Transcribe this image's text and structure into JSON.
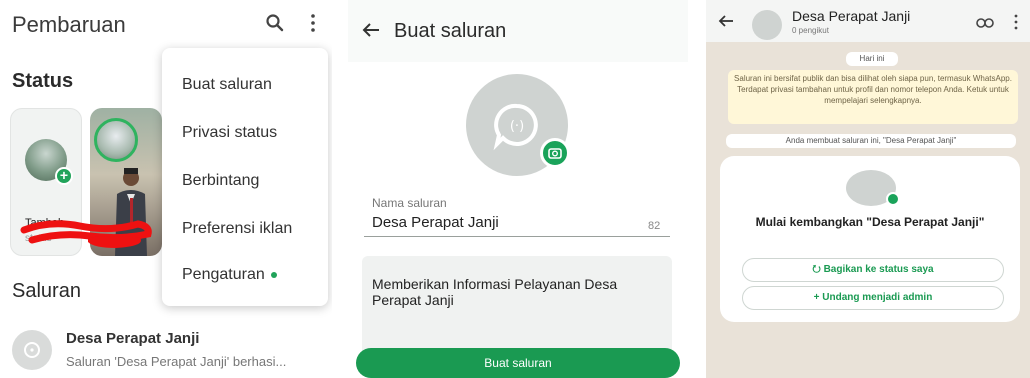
{
  "panel1": {
    "title": "Pembaruan",
    "icons": {
      "search": "search-icon",
      "menu": "kebab-menu-icon"
    },
    "status_heading": "Status",
    "status_add": {
      "label": "Tambah",
      "sublabel": "status"
    },
    "channels_heading": "Saluran",
    "channel": {
      "name": "Desa Perapat Janji",
      "preview": "Saluran 'Desa Perapat Janji' berhasi..."
    },
    "menu": [
      {
        "label": "Buat saluran"
      },
      {
        "label": "Privasi status"
      },
      {
        "label": "Berbintang"
      },
      {
        "label": "Preferensi iklan"
      },
      {
        "label": "Pengaturan",
        "dot": true
      }
    ],
    "accent_color": "#21a35a"
  },
  "panel2": {
    "title": "Buat saluran",
    "name_label": "Nama saluran",
    "name_value": "Desa Perapat Janji",
    "name_remaining": "82",
    "description": "Memberikan Informasi Pelayanan Desa Perapat Janji",
    "submit_label": "Buat saluran",
    "button_color": "#1a9a52"
  },
  "panel3": {
    "channel_name": "Desa Perapat Janji",
    "followers": "0 pengikut",
    "date_chip": "Hari ini",
    "info_text": "Saluran ini bersifat publik dan bisa dilihat oleh siapa pun, termasuk WhatsApp. Terdapat privasi tambahan untuk profil dan nomor telepon Anda. Ketuk untuk mempelajari selengkapnya.",
    "created_text": "Anda membuat saluran ini, \"Desa Perapat Janji\"",
    "card_title": "Mulai kembangkan \"Desa Perapat Janji\"",
    "share_button": "Bagikan ke status saya",
    "invite_button": "+  Undang menjadi admin"
  }
}
